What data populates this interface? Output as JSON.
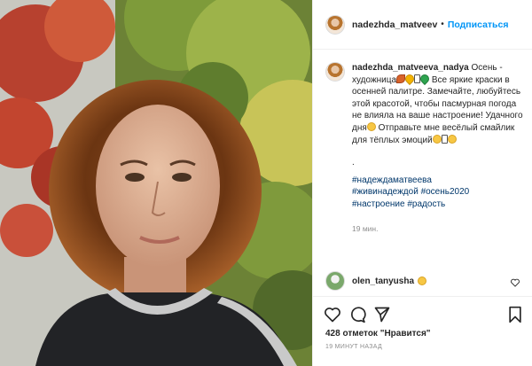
{
  "header": {
    "username": "nadezhda_matveev",
    "separator": "•",
    "follow_label": "Подписаться",
    "more_icon": "more-horizontal-icon"
  },
  "caption": {
    "username": "nadezhda_matveeva_nadya",
    "line1": "Осень - художница",
    "line2": "Все яркие краски в осенней палитре. Замечайте, любуйтесь этой красотой, чтобы пасмурная погода не влияла на ваше настроение! Удачного дня",
    "line3": "Отправьте мне весёлый смайлик для тёплых эмоций",
    "dot": ".",
    "hashtags": [
      "#надеждаматвеева",
      "#живинадеждой",
      "#осень2020",
      "#настроение",
      "#радость"
    ],
    "time": "19 мин."
  },
  "comment": {
    "username": "olen_tanyusha",
    "icon": "smile-emoji"
  },
  "actions": {
    "likes": "428 отметок \"Нравится\"",
    "time": "19 МИНУТ НАЗАД"
  },
  "colors": {
    "link": "#0095f6",
    "hashtag": "#00376b",
    "muted": "#8e8e8e",
    "text": "#262626",
    "border": "#efefef"
  }
}
